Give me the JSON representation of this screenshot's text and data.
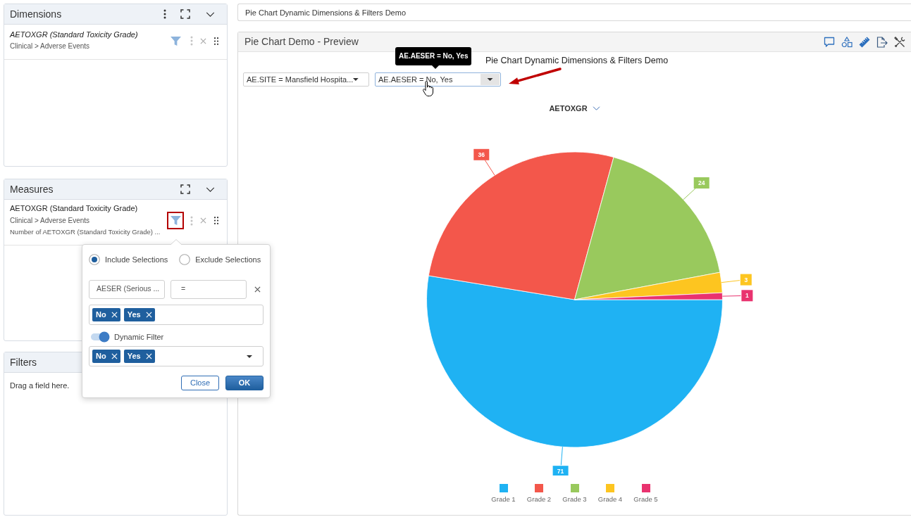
{
  "dimensions_panel": {
    "title": "Dimensions",
    "items": [
      {
        "name": "AETOXGR (Standard Toxicity Grade)",
        "path": "Clinical > Adverse Events",
        "highlighted": false
      }
    ]
  },
  "measures_panel": {
    "title": "Measures",
    "items": [
      {
        "name": "AETOXGR (Standard Toxicity Grade)",
        "path": "Clinical > Adverse Events",
        "aggregation": "Number of AETOXGR (Standard Toxicity Grade) ...",
        "highlighted": true
      }
    ]
  },
  "filters_panel": {
    "title": "Filters",
    "drop_hint": "Drag a field here."
  },
  "filter_popover": {
    "modes": [
      {
        "label": "Include Selections",
        "selected": true
      },
      {
        "label": "Exclude Selections",
        "selected": false
      }
    ],
    "field": "AESER (Serious ...",
    "operator": "=",
    "values": [
      "No",
      "Yes"
    ],
    "dynamic_filter": {
      "label": "Dynamic Filter",
      "on": true
    },
    "dynamic_values": [
      "No",
      "Yes"
    ],
    "buttons": [
      {
        "label": "Close",
        "kind": "secondary"
      },
      {
        "label": "OK",
        "kind": "primary"
      }
    ]
  },
  "report_title": {
    "value": "Pie Chart Dynamic Dimensions & Filters Demo"
  },
  "preview": {
    "title": "Pie Chart Demo - Preview",
    "filters": [
      {
        "label": "AE.SITE = Mansfield Hospita...",
        "focused": false
      },
      {
        "label": "AE.AESER = No, Yes",
        "focused": true
      }
    ],
    "tooltip": "AE.AESER = No, Yes",
    "callout": "Pie Chart Dynamic Dimensions & Filters Demo",
    "chart": {
      "chart_data": {
        "type": "pie",
        "title": "AETOXGR",
        "categories": [
          "Grade 1",
          "Grade 2",
          "Grade 3",
          "Grade 4",
          "Grade 5"
        ],
        "values": [
          71,
          36,
          24,
          3,
          1
        ],
        "colors": [
          "#1fb2f3",
          "#f3574b",
          "#99c95d",
          "#fdc520",
          "#e9336f"
        ],
        "data_labels": true,
        "legend": "bottom"
      }
    }
  }
}
